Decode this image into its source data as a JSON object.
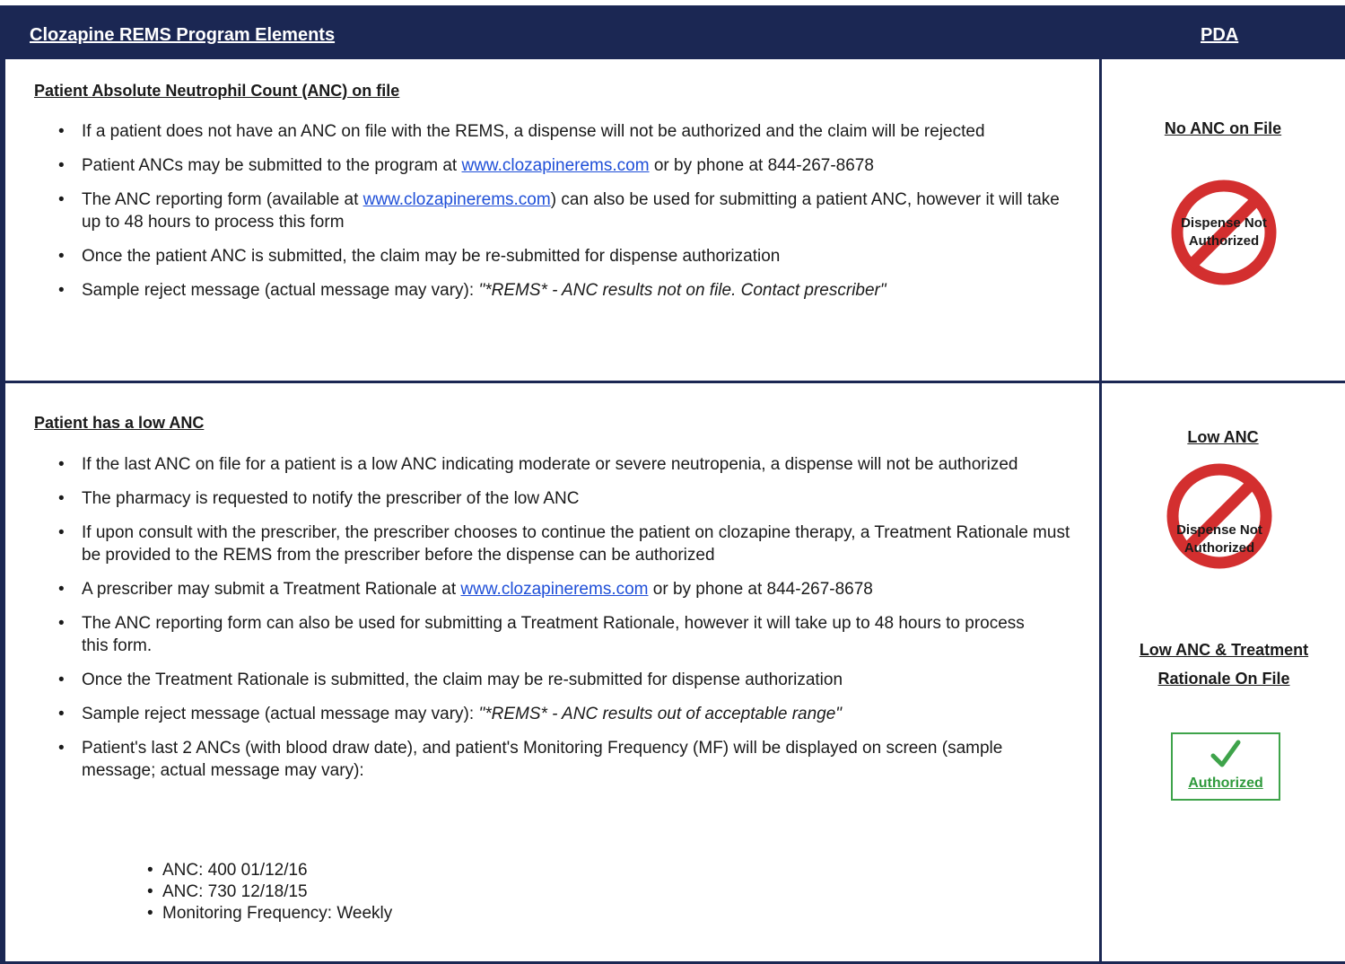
{
  "header": {
    "left": "Clozapine REMS Program Elements",
    "right": "PDA"
  },
  "section1": {
    "title": "Patient Absolute Neutrophil Count (ANC) on file",
    "bullets": {
      "b1": "If a patient does not have an ANC on file with the REMS, a dispense will not be authorized and the claim will be rejected",
      "b2_pre": "Patient ANCs may be submitted to the program at ",
      "b2_link": "www.clozapinerems.com",
      "b2_post": " or by phone at 844-267-8678",
      "b3_pre": "The ANC reporting form (available at ",
      "b3_link": "www.clozapinerems.com",
      "b3_post": ") can also be used for submitting a patient ANC, however it will take up to 48 hours to process this form",
      "b4": "Once the patient ANC is submitted, the claim may be re-submitted for dispense authorization",
      "b5_pre": "Sample reject message (actual message may vary): ",
      "b5_quote": "\"*REMS* - ANC results not on file. Contact prescriber\""
    },
    "status": {
      "title": "No ANC on File",
      "sign_text": "Dispense Not Authorized"
    }
  },
  "section2": {
    "title": "Patient has a low ANC",
    "bullets": {
      "b1": "If the last ANC on file for a patient is a low ANC indicating moderate or severe neutropenia, a dispense will not be authorized",
      "b2": "The pharmacy is requested to notify the prescriber of the low ANC",
      "b3": "If upon consult with the prescriber, the prescriber chooses to continue the patient on clozapine therapy, a Treatment Rationale must be provided to the REMS from the prescriber before the dispense can be authorized",
      "b4_pre": "A prescriber may submit a Treatment Rationale at ",
      "b4_link": "www.clozapinerems.com",
      "b4_post": " or by phone at 844-267-8678",
      "b5": "The ANC reporting form can also be used for submitting a Treatment Rationale, however it will take up to 48 hours to process this form.",
      "b6": "Once the Treatment Rationale is submitted, the claim may be re-submitted for dispense authorization",
      "b7_pre": "Sample reject message (actual message may vary): ",
      "b7_quote": "\"*REMS* - ANC results out of acceptable range\"",
      "b8": "Patient's last 2 ANCs (with blood draw date), and patient's Monitoring Frequency (MF) will be displayed on screen (sample message; actual message may vary):"
    },
    "sub_items": {
      "s1": "ANC:  400 01/12/16",
      "s2": "ANC:  730 12/18/15",
      "s3": "Monitoring Frequency:  Weekly"
    },
    "status_low": {
      "title": "Low ANC",
      "sign_text": "Dispense Not Authorized"
    },
    "status_auth": {
      "title": "Low ANC & Treatment Rationale On File",
      "box_label": "Authorized"
    }
  },
  "colors": {
    "navy": "#1b2753",
    "link": "#1f4fd8",
    "prohibit_red": "#d32f2f",
    "auth_green": "#2f9a3c"
  }
}
